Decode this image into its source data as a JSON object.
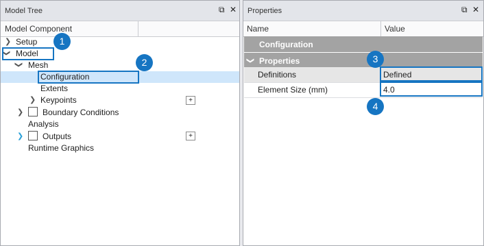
{
  "tree_panel": {
    "title": "Model Tree",
    "column_header": "Model Component",
    "items": [
      {
        "label": "Setup"
      },
      {
        "label": "Model"
      },
      {
        "label": "Mesh"
      },
      {
        "label": "Configuration"
      },
      {
        "label": "Extents"
      },
      {
        "label": "Keypoints"
      },
      {
        "label": "Boundary Conditions"
      },
      {
        "label": "Analysis"
      },
      {
        "label": "Outputs"
      },
      {
        "label": "Runtime Graphics"
      }
    ],
    "plus_symbol": "+"
  },
  "props_panel": {
    "title": "Properties",
    "columns": {
      "name": "Name",
      "value": "Value"
    },
    "section_title": "Configuration",
    "group_title": "Properties",
    "rows": [
      {
        "name": "Definitions",
        "value": "Defined"
      },
      {
        "name": "Element Size (mm)",
        "value": "4.0"
      }
    ]
  },
  "window_controls": {
    "pin": "⧉",
    "close": "✕"
  },
  "badges": [
    "1",
    "2",
    "3",
    "4"
  ],
  "colors": {
    "accent": "#1675c2",
    "selection": "#cfe6fb",
    "group_band": "#a3a3a3"
  }
}
